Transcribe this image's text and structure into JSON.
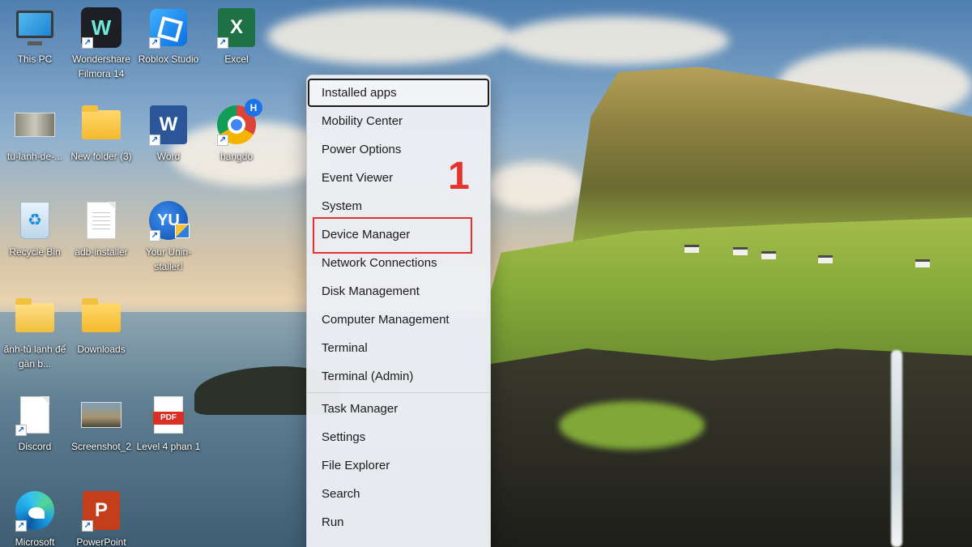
{
  "desktop": {
    "icons": [
      {
        "label": "This PC",
        "icon": "this-pc-icon"
      },
      {
        "label": "Wondershare Filmora 14",
        "icon": "filmora-icon",
        "glyph": "W"
      },
      {
        "label": "Roblox Studio",
        "icon": "roblox-studio-icon"
      },
      {
        "label": "Excel",
        "icon": "excel-icon",
        "glyph": "X"
      },
      {
        "label": "tu-lanh-de-...",
        "icon": "image-file-icon"
      },
      {
        "label": "New folder (3)",
        "icon": "folder-icon"
      },
      {
        "label": "Word",
        "icon": "word-icon",
        "glyph": "W"
      },
      {
        "label": "hangdo",
        "icon": "chrome-profile-icon",
        "badge": "H"
      },
      {
        "label": "Recycle Bin",
        "icon": "recycle-bin-icon",
        "glyph": "♻"
      },
      {
        "label": "adb-installer",
        "icon": "document-icon"
      },
      {
        "label": "Your Unin-staller!",
        "icon": "uninstaller-icon",
        "glyph": "YU"
      },
      {
        "label": "ảnh-tủ lạnh để gần b...",
        "icon": "zip-folder-icon"
      },
      {
        "label": "Downloads",
        "icon": "downloads-folder-icon"
      },
      {
        "label": "Discord",
        "icon": "discord-file-icon"
      },
      {
        "label": "Screenshot_2",
        "icon": "screenshot-image-icon"
      },
      {
        "label": "Level 4 phan 1",
        "icon": "pdf-icon",
        "glyph": "PDF"
      },
      {
        "label": "Microsoft",
        "icon": "edge-icon"
      },
      {
        "label": "PowerPoint",
        "icon": "powerpoint-icon",
        "glyph": "P"
      }
    ]
  },
  "context_menu": {
    "items": [
      {
        "label": "Installed apps",
        "name": "installed-apps"
      },
      {
        "label": "Mobility Center",
        "name": "mobility-center"
      },
      {
        "label": "Power Options",
        "name": "power-options"
      },
      {
        "label": "Event Viewer",
        "name": "event-viewer"
      },
      {
        "label": "System",
        "name": "system"
      },
      {
        "label": "Device Manager",
        "name": "device-manager"
      },
      {
        "label": "Network Connections",
        "name": "network-connections"
      },
      {
        "label": "Disk Management",
        "name": "disk-management"
      },
      {
        "label": "Computer Management",
        "name": "computer-management"
      },
      {
        "label": "Terminal",
        "name": "terminal"
      },
      {
        "label": "Terminal (Admin)",
        "name": "terminal-admin"
      },
      {
        "label": "Task Manager",
        "name": "task-manager"
      },
      {
        "label": "Settings",
        "name": "settings"
      },
      {
        "label": "File Explorer",
        "name": "file-explorer"
      },
      {
        "label": "Search",
        "name": "search"
      },
      {
        "label": "Run",
        "name": "run"
      }
    ]
  },
  "annotation": {
    "step_number": "1",
    "color": "#e5322d"
  }
}
